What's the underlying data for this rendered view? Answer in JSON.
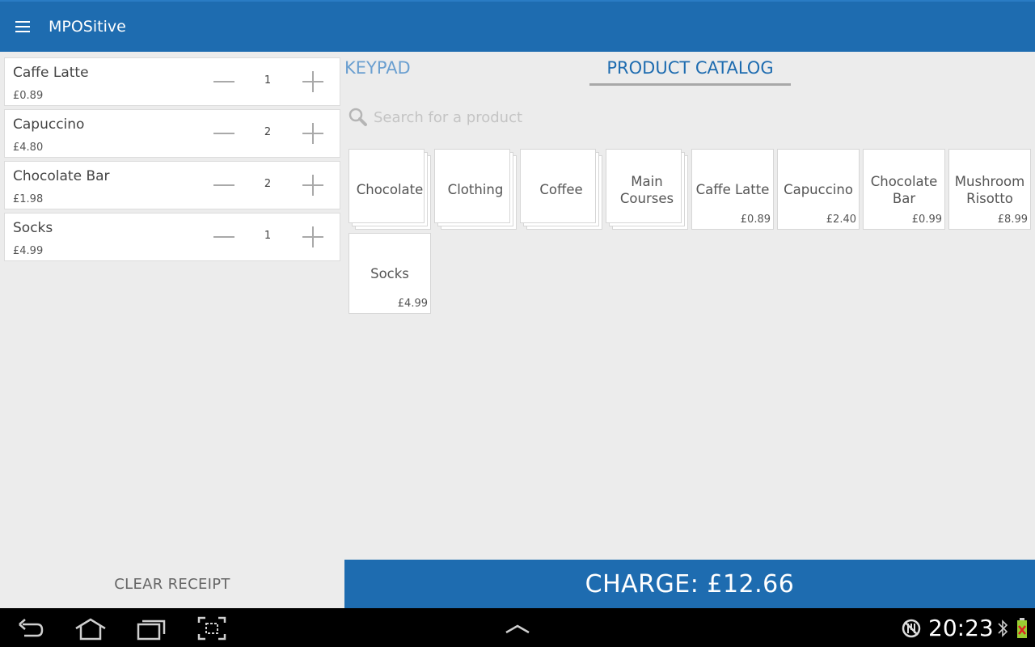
{
  "app": {
    "title": "MPOSitive"
  },
  "receipt": {
    "items": [
      {
        "name": "Caffe Latte",
        "price": "£0.89",
        "qty": "1"
      },
      {
        "name": "Capuccino",
        "price": "£4.80",
        "qty": "2"
      },
      {
        "name": "Chocolate Bar",
        "price": "£1.98",
        "qty": "2"
      },
      {
        "name": "Socks",
        "price": "£4.99",
        "qty": "1"
      }
    ],
    "clear_label": "CLEAR RECEIPT"
  },
  "tabs": {
    "keypad": "KEYPAD",
    "catalog": "PRODUCT CATALOG",
    "active": "catalog"
  },
  "search": {
    "placeholder": "Search for a product"
  },
  "catalog": {
    "categories": [
      {
        "line1": "Chocolate"
      },
      {
        "line1": "Clothing"
      },
      {
        "line1": "Coffee"
      },
      {
        "line1": "Main",
        "line2": "Courses"
      }
    ],
    "products": [
      {
        "line1": "Caffe Latte",
        "price": "£0.89"
      },
      {
        "line1": "Capuccino",
        "price": "£2.40"
      },
      {
        "line1": "Chocolate",
        "line2": "Bar",
        "price": "£0.99"
      },
      {
        "line1": "Mushroom",
        "line2": "Risotto",
        "price": "£8.99"
      },
      {
        "line1": "Socks",
        "price": "£4.99"
      }
    ]
  },
  "charge": {
    "label": "CHARGE: £12.66"
  },
  "system": {
    "time": "20:23"
  },
  "colors": {
    "primary": "#1e6cb0",
    "background": "#ececec"
  },
  "icons": [
    "menu-icon",
    "search-icon",
    "back-icon",
    "home-icon",
    "recent-apps-icon",
    "screenshot-icon",
    "up-chevron-icon",
    "no-sim-icon",
    "bluetooth-icon",
    "battery-icon"
  ]
}
